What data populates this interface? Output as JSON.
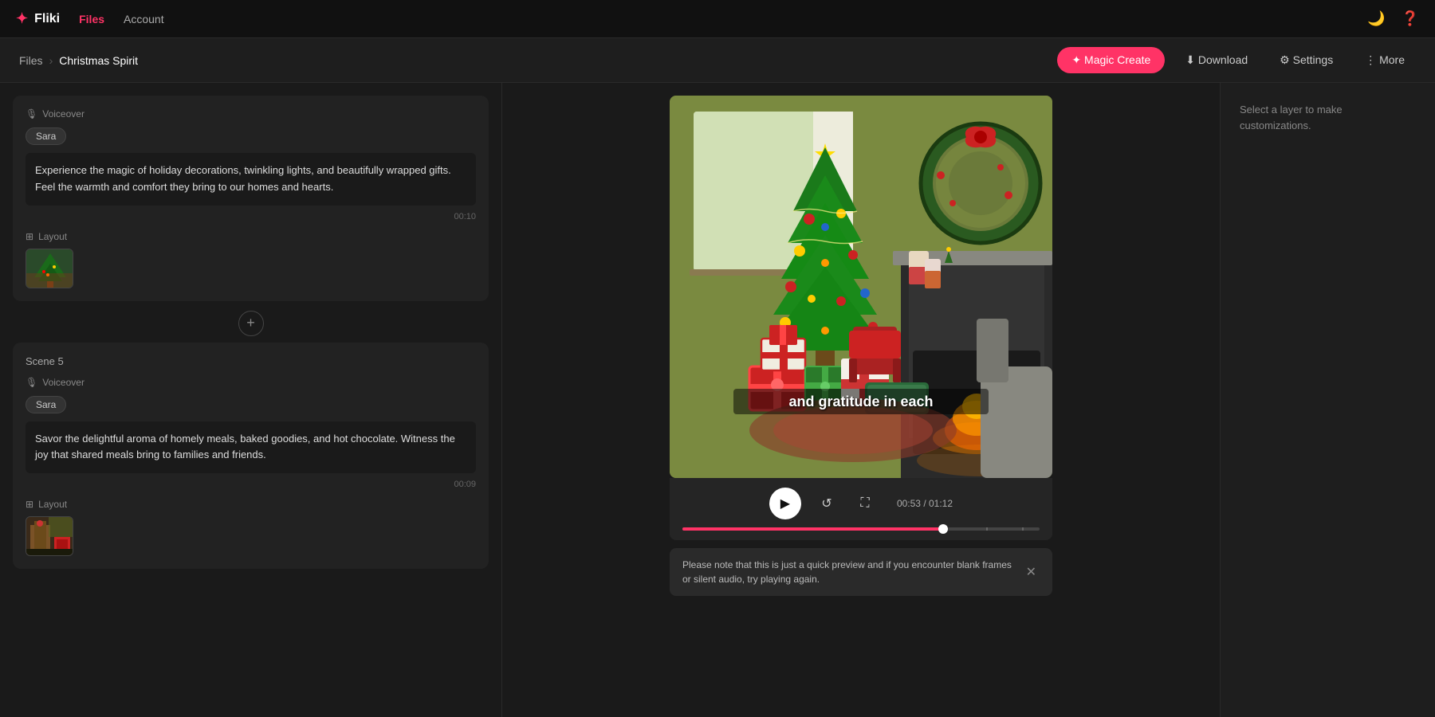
{
  "app": {
    "logo": "✦",
    "name": "Fliki",
    "nav_items": [
      {
        "id": "files",
        "label": "Files",
        "active": true
      },
      {
        "id": "account",
        "label": "Account",
        "active": false
      }
    ]
  },
  "header": {
    "breadcrumb_root": "Files",
    "breadcrumb_current": "Christmas Spirit",
    "btn_magic": "✦ Magic Create",
    "btn_download": "⬇ Download",
    "btn_settings": "⚙ Settings",
    "btn_more": "⋮ More"
  },
  "scenes": [
    {
      "id": "scene4",
      "voiceover_label": "Voiceover",
      "speaker": "Sara",
      "text": "Experience the magic of holiday decorations, twinkling lights, and beautifully wrapped gifts. Feel the warmth and comfort they bring to our homes and hearts.",
      "duration": "00:10",
      "layout_label": "Layout"
    },
    {
      "id": "scene5",
      "label": "Scene 5",
      "voiceover_label": "Voiceover",
      "speaker": "Sara",
      "text": "Savor the delightful aroma of homely meals, baked goodies, and hot chocolate. Witness the joy that shared meals bring to families and friends.",
      "duration": "00:09",
      "layout_label": "Layout"
    }
  ],
  "video": {
    "subtitle": "and gratitude in each",
    "current_time": "00:53",
    "total_time": "01:12",
    "progress_percent": 73
  },
  "controls": {
    "play_icon": "▶",
    "replay_icon": "↺",
    "fullscreen_icon": "⛶"
  },
  "toast": {
    "message": "Please note that this is just a quick preview and if you encounter blank frames or silent audio, try playing again."
  },
  "right_panel": {
    "hint": "Select a layer to make customizations."
  }
}
